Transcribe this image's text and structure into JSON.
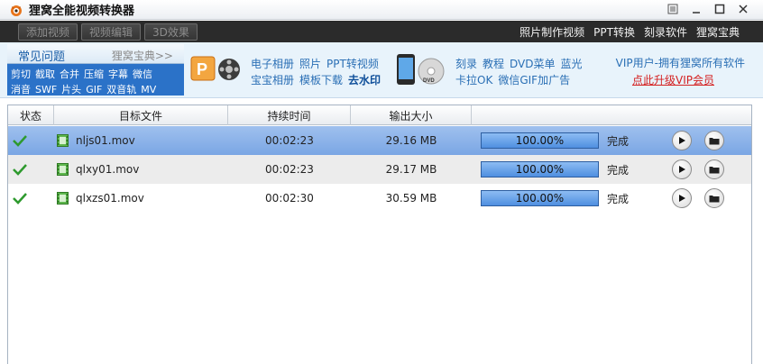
{
  "window": {
    "title": "狸窝全能视频转换器",
    "controls": [
      "menu-icon",
      "minimize-icon",
      "maximize-icon",
      "close-icon"
    ]
  },
  "toolbar": {
    "buttons": [
      "添加视频",
      "视频编辑",
      "3D效果"
    ],
    "links": [
      "照片制作视频",
      "PPT转换",
      "刻录软件",
      "狸窝宝典"
    ]
  },
  "banner": {
    "faq": {
      "title": "常见问题",
      "more": "狸窝宝典>>",
      "row1": [
        "剪切",
        "截取",
        "合并",
        "压缩",
        "字幕",
        "微信"
      ],
      "row2": [
        "消音",
        "SWF",
        "片头",
        "GIF",
        "双音轨",
        "MV"
      ]
    },
    "promo1": {
      "line1": [
        "电子相册",
        "照片",
        "PPT转视频"
      ],
      "line2": [
        "宝宝相册",
        "模板下载"
      ],
      "highlight": "去水印"
    },
    "promo2": {
      "line1": [
        "刻录",
        "教程",
        "DVD菜单",
        "蓝光"
      ],
      "line2": [
        "卡拉OK",
        "微信GIF加广告"
      ]
    },
    "vip": {
      "line": "VIP用户-拥有狸窝所有软件",
      "link": "点此升级VIP会员"
    }
  },
  "table": {
    "headers": [
      "状态",
      "目标文件",
      "持续时间",
      "输出大小",
      ""
    ],
    "rows": [
      {
        "file": "nljs01.mov",
        "duration": "00:02:23",
        "size": "29.16 MB",
        "progress": "100.00%",
        "status": "完成",
        "selected": true
      },
      {
        "file": "qlxy01.mov",
        "duration": "00:02:23",
        "size": "29.17 MB",
        "progress": "100.00%",
        "status": "完成",
        "selected": false
      },
      {
        "file": "qlxzs01.mov",
        "duration": "00:02:30",
        "size": "30.59 MB",
        "progress": "100.00%",
        "status": "完成",
        "selected": false
      }
    ]
  },
  "colors": {
    "selected_row": "#8fb4ea",
    "faq_panel": "#2b72c8",
    "progress": "#5a96e4",
    "vip_link": "#d42020"
  }
}
